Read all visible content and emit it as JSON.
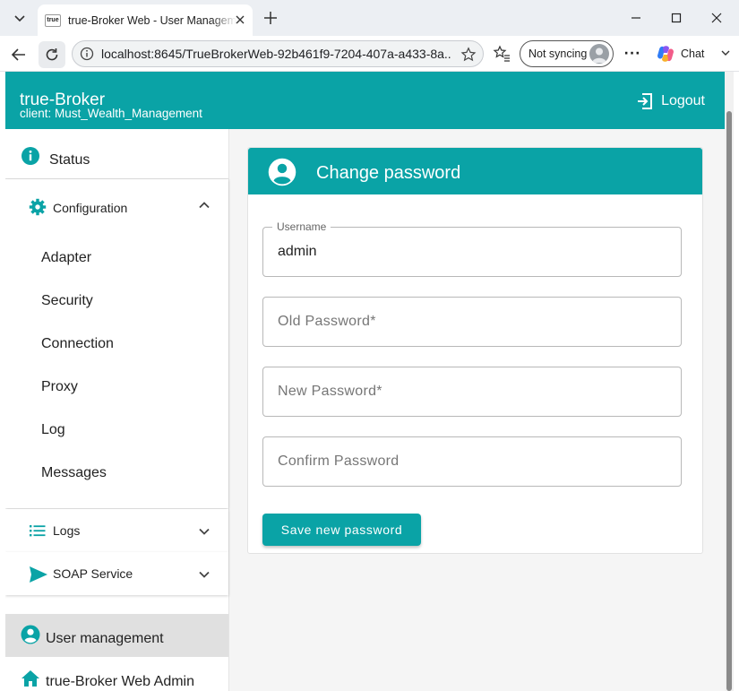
{
  "browser": {
    "tab": {
      "favicon_text": "true",
      "title": "true-Broker Web - User Management"
    },
    "address": {
      "url": "localhost:8645/TrueBrokerWeb-92b461f9-7204-407a-a433-8a..."
    },
    "sync_label": "Not syncing",
    "chat_label": "Chat"
  },
  "app": {
    "title": "true-Broker",
    "client": "client: Must_Wealth_Management",
    "logout_label": "Logout",
    "accent_color": "#0aa3a6"
  },
  "sidebar": {
    "status_label": "Status",
    "configuration": {
      "label": "Configuration",
      "expanded": true,
      "items": [
        "Adapter",
        "Security",
        "Connection",
        "Proxy",
        "Log",
        "Messages"
      ]
    },
    "logs_label": "Logs",
    "soap_label": "SOAP Service",
    "user_management_label": "User management",
    "admin_label": "true-Broker Web Admin"
  },
  "main": {
    "card_title": "Change password",
    "username": {
      "label": "Username",
      "value": "admin"
    },
    "old_password": {
      "placeholder": "Old Password*"
    },
    "new_password": {
      "placeholder": "New Password*"
    },
    "confirm_password": {
      "placeholder": "Confirm Password"
    },
    "save_label": "Save new password"
  }
}
